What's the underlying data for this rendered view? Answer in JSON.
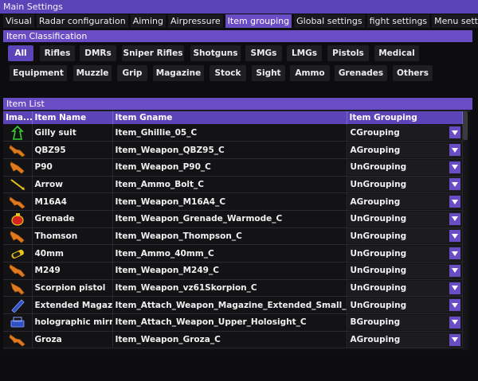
{
  "window": {
    "title": "Main Settings"
  },
  "tabs": [
    {
      "label": "Visual",
      "active": false
    },
    {
      "label": "Radar configuration",
      "active": false
    },
    {
      "label": "Aiming",
      "active": false
    },
    {
      "label": "Airpressure",
      "active": false
    },
    {
      "label": "Item grouping",
      "active": true
    },
    {
      "label": "Global settings",
      "active": false
    },
    {
      "label": "fight settings",
      "active": false
    },
    {
      "label": "Menu settings",
      "active": false
    }
  ],
  "classification": {
    "title": "Item Classification",
    "selected": "All",
    "row1": [
      "All",
      "Rifles",
      "DMRs",
      "Sniper Rifles",
      "Shotguns",
      "SMGs",
      "LMGs",
      "Pistols",
      "Medical"
    ],
    "row2": [
      "Equipment",
      "Muzzle",
      "Grip",
      "Magazine",
      "Stock",
      "Sight",
      "Ammo",
      "Grenades",
      "Others"
    ]
  },
  "item_list": {
    "title": "Item List",
    "columns": [
      "Ima...",
      "Item Name",
      "Item Gname",
      "Item Grouping"
    ],
    "rows": [
      {
        "icon": "ghillie-suit-icon",
        "name": "Gilly suit",
        "gname": "Item_Ghillie_05_C",
        "grouping": "CGrouping"
      },
      {
        "icon": "rifle-icon",
        "name": "QBZ95",
        "gname": "Item_Weapon_QBZ95_C",
        "grouping": "AGrouping"
      },
      {
        "icon": "smg-icon",
        "name": "P90",
        "gname": "Item_Weapon_P90_C",
        "grouping": "UnGrouping"
      },
      {
        "icon": "arrow-bolt-icon",
        "name": "Arrow",
        "gname": "Item_Ammo_Bolt_C",
        "grouping": "UnGrouping"
      },
      {
        "icon": "rifle-icon",
        "name": "M16A4",
        "gname": "Item_Weapon_M16A4_C",
        "grouping": "AGrouping"
      },
      {
        "icon": "grenade-icon",
        "name": "Grenade",
        "gname": "Item_Weapon_Grenade_Warmode_C",
        "grouping": "UnGrouping"
      },
      {
        "icon": "smg-icon",
        "name": "Thomson",
        "gname": "Item_Weapon_Thompson_C",
        "grouping": "UnGrouping"
      },
      {
        "icon": "ammo-40mm-icon",
        "name": "40mm",
        "gname": "Item_Ammo_40mm_C",
        "grouping": "UnGrouping"
      },
      {
        "icon": "lmg-icon",
        "name": "M249",
        "gname": "Item_Weapon_M249_C",
        "grouping": "UnGrouping"
      },
      {
        "icon": "pistol-icon",
        "name": "Scorpion pistol",
        "gname": "Item_Weapon_vz61Skorpion_C",
        "grouping": "UnGrouping"
      },
      {
        "icon": "magazine-icon",
        "name": "Extended Magazine",
        "gname": "Item_Attach_Weapon_Magazine_Extended_Small_C",
        "grouping": "UnGrouping"
      },
      {
        "icon": "holographic-sight-icon",
        "name": "holographic mirror",
        "gname": "Item_Attach_Weapon_Upper_Holosight_C",
        "grouping": "BGrouping"
      },
      {
        "icon": "rifle-icon",
        "name": "Groza",
        "gname": "Item_Weapon_Groza_C",
        "grouping": "AGrouping"
      }
    ]
  },
  "colors": {
    "accent": "#6a4cc4",
    "header": "#5b44b8",
    "background": "#0d0d0f"
  }
}
